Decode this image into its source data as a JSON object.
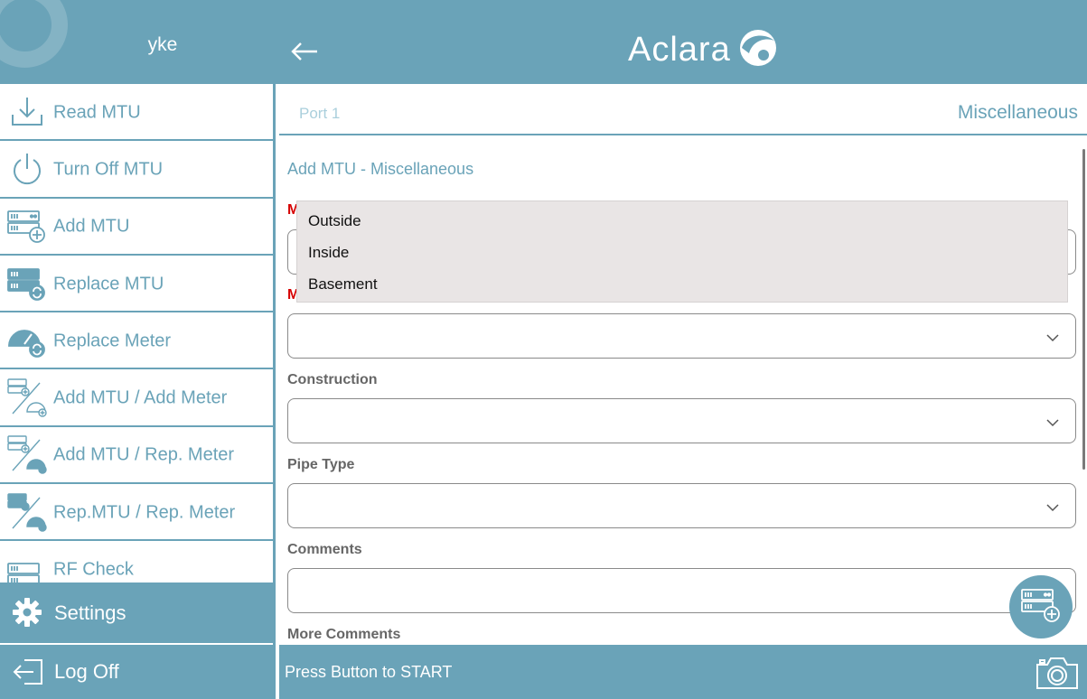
{
  "sidebar": {
    "username": "yke",
    "items": [
      {
        "label": "Read MTU",
        "icon": "download-icon"
      },
      {
        "label": "Turn Off MTU",
        "icon": "power-icon"
      },
      {
        "label": "Add MTU",
        "icon": "mtu-add-icon"
      },
      {
        "label": "Replace MTU",
        "icon": "mtu-replace-icon"
      },
      {
        "label": "Replace Meter",
        "icon": "meter-replace-icon"
      },
      {
        "label": "Add MTU / Add Meter",
        "icon": "mtu-add-meter-icon"
      },
      {
        "label": "Add MTU / Rep. Meter",
        "icon": "mtu-add-rep-meter-icon"
      },
      {
        "label": "Rep.MTU / Rep. Meter",
        "icon": "mtu-rep-rep-meter-icon"
      },
      {
        "label": "RF Check",
        "icon": "rf-check-icon"
      }
    ],
    "settings_label": "Settings",
    "logoff_label": "Log Off"
  },
  "header": {
    "logo_text": "Aclara"
  },
  "portbar": {
    "port_label": "Port 1",
    "section_label": "Miscellaneous"
  },
  "form": {
    "title": "Add MTU - Miscellaneous",
    "req_label_1": "M",
    "req_label_2": "M",
    "construction_label": "Construction",
    "pipe_type_label": "Pipe Type",
    "comments_label": "Comments",
    "more_comments_label": "More Comments"
  },
  "dropdown": {
    "options": [
      "Outside",
      "Inside",
      "Basement"
    ]
  },
  "bottom": {
    "start_text": "Press Button to START"
  },
  "colors": {
    "brand": "#6aa3b8",
    "required": "#d60000"
  }
}
